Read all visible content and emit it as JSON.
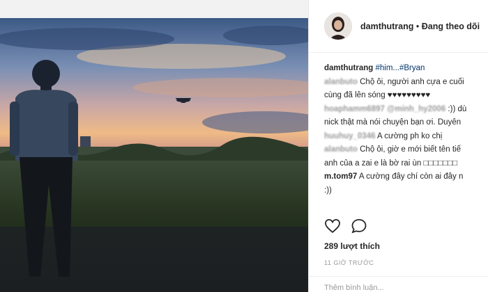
{
  "post": {
    "username": "damthutrang",
    "separator": " • ",
    "follow_status": "Đang theo dõi",
    "caption_username": "damthutrang",
    "caption_text": " #him...#Bryan"
  },
  "comments": [
    {
      "user": "alanbuto",
      "text": " Chộ ôi, người anh cựa e cuối",
      "blurred": true
    },
    {
      "user": "",
      "text": "cùng đã lên sóng ♥♥♥♥♥♥♥♥♥",
      "blurred": false
    },
    {
      "user": "hoaphamm6897",
      "mention": " @minh_hy2006",
      "text": " :)) dù",
      "blurred": true
    },
    {
      "user": "",
      "text": "nick thật mà nói chuyện bạn ơi. Duyên",
      "blurred": false
    },
    {
      "user": "huuhuy_0346",
      "text": " A cường ph ko chị",
      "blurred": true
    },
    {
      "user": "alanbuto",
      "text": " Chộ ôi, giờ e mới biết tên tiế",
      "blurred": true
    },
    {
      "user": "",
      "text": "anh của a zai e là bờ rai ùn □□□□□□□",
      "blurred": false
    },
    {
      "user": "m.tom97",
      "text": " A cường đây chí còn ai đây n",
      "blurred": false
    },
    {
      "user": "",
      "text": ":))",
      "blurred": false
    }
  ],
  "icons": {
    "like": "heart-icon",
    "comment": "comment-bubble-icon"
  },
  "likes_text": "289 lượt thích",
  "time_text": "11 GIỜ TRƯỚC",
  "add_comment_placeholder": "Thêm bình luận..."
}
